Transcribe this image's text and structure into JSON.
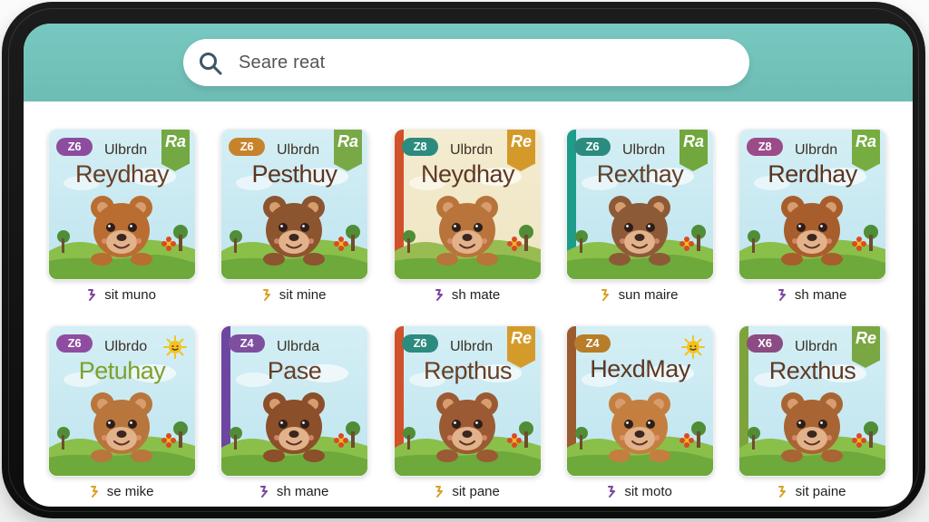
{
  "search": {
    "placeholder": "Seare reat"
  },
  "books": [
    {
      "age": "Z6",
      "series": "Ulbrdn",
      "title": "Reydhay",
      "level": "Ra",
      "caption": "sit muno",
      "badgeColor": "#8c4d9f",
      "tagColor": "#73a843",
      "spineColor": "",
      "titleColor": "#6a3d24"
    },
    {
      "age": "Z6",
      "series": "Ulbrdn",
      "title": "Pesthuy",
      "level": "Ra",
      "caption": "sit mine",
      "badgeColor": "#c7832b",
      "tagColor": "#79a947",
      "spineColor": "",
      "titleColor": "#5d3420"
    },
    {
      "age": "Z8",
      "series": "Ulbrdn",
      "title": "Neydhay",
      "level": "Re",
      "caption": "sh mate",
      "badgeColor": "#2c8b7f",
      "tagColor": "#d39a2a",
      "spineColor": "#d1512a",
      "titleColor": "#5f3824"
    },
    {
      "age": "Z6",
      "series": "Ulbrdn",
      "title": "Rexthay",
      "level": "Ra",
      "caption": "sun maire",
      "badgeColor": "#2c8b7f",
      "tagColor": "#71a73d",
      "spineColor": "#1d9c8a",
      "titleColor": "#63402b"
    },
    {
      "age": "Z8",
      "series": "Ulbrdn",
      "title": "Rerdhay",
      "level": "Ra",
      "caption": "sh mane",
      "badgeColor": "#9a4b88",
      "tagColor": "#77ad40",
      "spineColor": "",
      "titleColor": "#5b3320"
    },
    {
      "age": "Z6",
      "series": "Ulbrdo",
      "title": "Petuhay",
      "level": "",
      "caption": "se mike",
      "badgeColor": "#8e4da1",
      "tagColor": "",
      "spineColor": "",
      "titleColor": "#7ea12b"
    },
    {
      "age": "Z4",
      "series": "Ulbrda",
      "title": "Pase",
      "level": "",
      "caption": "sh mane",
      "badgeColor": "#7f4f9f",
      "tagColor": "",
      "spineColor": "#6c46a0",
      "titleColor": "#673d26"
    },
    {
      "age": "Z6",
      "series": "Ulbrdn",
      "title": "Repthus",
      "level": "Re",
      "caption": "sit pane",
      "badgeColor": "#2c8b7f",
      "tagColor": "#d59b2a",
      "spineColor": "#d1512a",
      "titleColor": "#6a3d24"
    },
    {
      "age": "Z4",
      "series": "",
      "title": "HexdMay",
      "level": "",
      "caption": "sit moto",
      "badgeColor": "#b77d28",
      "tagColor": "",
      "spineColor": "#9a5b2e",
      "titleColor": "#5d3723"
    },
    {
      "age": "X6",
      "series": "Ulbrdn",
      "title": "Rexthus",
      "level": "Re",
      "caption": "sit paine",
      "badgeColor": "#8c4b82",
      "tagColor": "#7aa743",
      "spineColor": "#7da33d",
      "titleColor": "#5f3824"
    }
  ]
}
